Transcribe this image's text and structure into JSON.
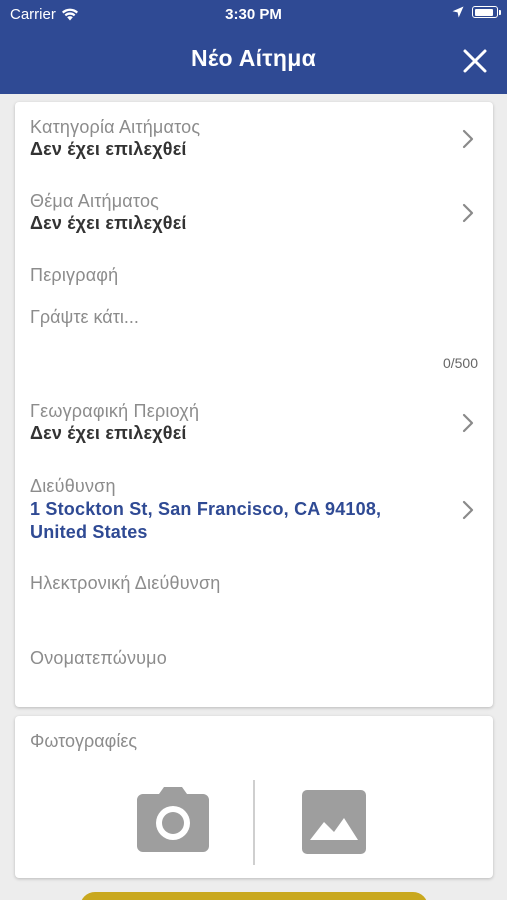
{
  "status_bar": {
    "carrier": "Carrier",
    "time": "3:30 PM"
  },
  "header": {
    "title": "Νέο Αίτημα"
  },
  "form": {
    "category": {
      "label": "Κατηγορία Αιτήματος",
      "value": "Δεν έχει επιλεχθεί"
    },
    "subject": {
      "label": "Θέμα Αιτήματος",
      "value": "Δεν έχει επιλεχθεί"
    },
    "description": {
      "label": "Περιγραφή",
      "placeholder": "Γράψτε κάτι...",
      "counter": "0/500"
    },
    "region": {
      "label": "Γεωγραφική Περιοχή",
      "value": "Δεν έχει επιλεχθεί"
    },
    "address": {
      "label": "Διεύθυνση",
      "value_line1": "1 Stockton St, San Francisco, CA  94108,",
      "value_line2": "United States"
    },
    "email": {
      "label": "Ηλεκτρονική Διεύθυνση",
      "value": ""
    },
    "fullname": {
      "label": "Ονοματεπώνυμο",
      "value": ""
    }
  },
  "photos": {
    "label": "Φωτογραφίες"
  },
  "colors": {
    "header_bg": "#2f4a94",
    "accent": "#2f4a94",
    "submit_bg": "#c9a81e",
    "icon_gray": "#9e9e9e"
  },
  "icons": [
    "wifi-icon",
    "location-arrow-icon",
    "battery-icon",
    "close-icon",
    "chevron-right-icon",
    "camera-icon",
    "image-icon"
  ]
}
